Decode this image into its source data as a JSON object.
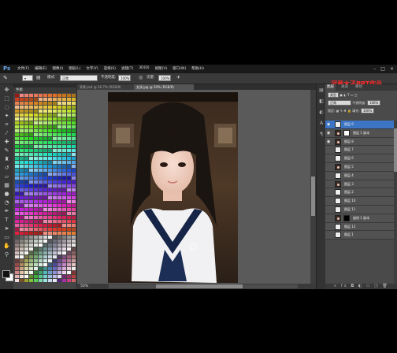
{
  "app": {
    "logo": "Ps"
  },
  "menu": [
    "文件(F)",
    "编辑(E)",
    "图像(I)",
    "图层(L)",
    "文字(Y)",
    "选择(S)",
    "滤镜(T)",
    "3D(D)",
    "视图(V)",
    "窗口(W)",
    "帮助(H)"
  ],
  "window_controls": [
    "–",
    "□",
    "×"
  ],
  "options": {
    "mode_label": "模式:",
    "mode_value": "正常",
    "opacity_label": "不透明度:",
    "opacity_value": "100%",
    "flow_label": "流量:",
    "flow_value": "100%"
  },
  "watermark": "河童木子PPT作品",
  "swatches": {
    "tab": "色板"
  },
  "document": {
    "tabs": [
      "背景.psd @ 16.7% (RGB/8)",
      "女孩.jpg @ 50% (RGB/8)"
    ],
    "zoom": "50%",
    "status": "文档:2.64M/19.4M"
  },
  "layers": {
    "tabs": [
      "图层",
      "通道",
      "路径"
    ],
    "kind_label": "类型",
    "blend": "正常",
    "opacity_label": "不透明度:",
    "opacity": "100%",
    "lock_label": "锁定:",
    "fill_label": "填充:",
    "fill": "100%",
    "items": [
      {
        "name": "图层 9",
        "thumb": "blank",
        "selected": true
      },
      {
        "name": "图层 1 副本",
        "thumb": "photo",
        "mask": "white"
      },
      {
        "name": "图层 8",
        "thumb": "photo"
      },
      {
        "name": "图层 7",
        "thumb": "blank"
      },
      {
        "name": "图层 6",
        "thumb": "blank"
      },
      {
        "name": "图层 5",
        "thumb": "photo"
      },
      {
        "name": "图层 4",
        "thumb": "blank"
      },
      {
        "name": "图层 3",
        "thumb": "photo"
      },
      {
        "name": "图层 2",
        "thumb": "blank"
      },
      {
        "name": "图层 10",
        "thumb": "blank"
      },
      {
        "name": "图层 11",
        "thumb": "blank"
      },
      {
        "name": "曲线 1 副本",
        "thumb": "photo",
        "mask": "black"
      },
      {
        "name": "图层 12",
        "thumb": "blank"
      },
      {
        "name": "图层 1",
        "thumb": "blank"
      }
    ],
    "footer_icons": "∞ fx ◘ ◐ ▭ ◳ 🗑"
  },
  "colors": {
    "accent_selected": "#3b75c4",
    "watermark": "#ff2a2a"
  }
}
